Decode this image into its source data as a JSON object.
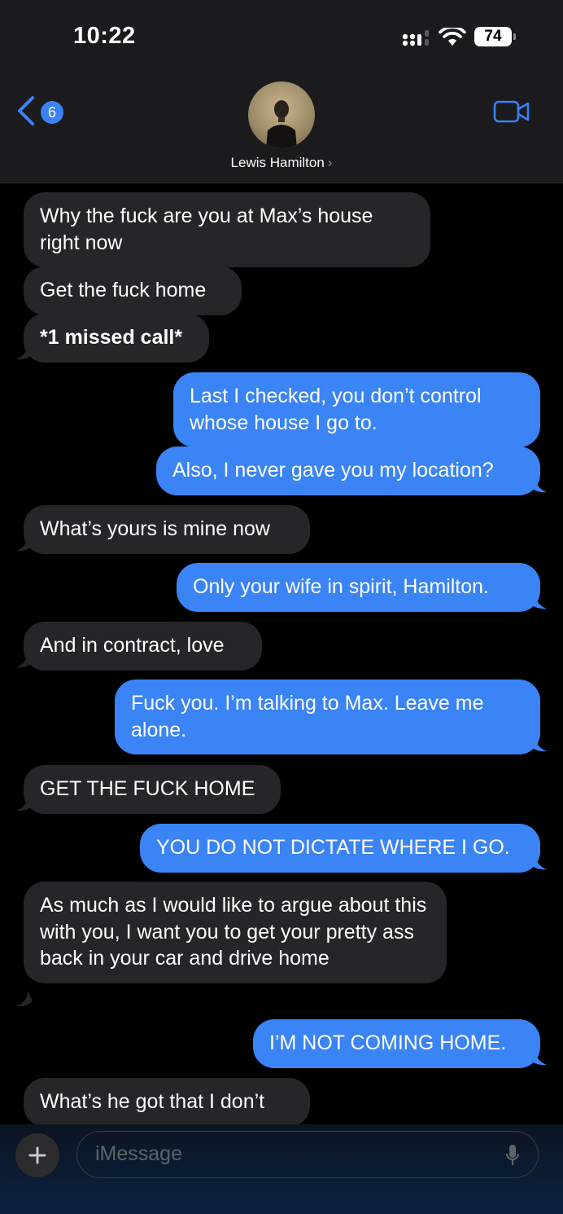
{
  "status_bar": {
    "time": "10:22",
    "battery": "74"
  },
  "header": {
    "back_count": "6",
    "contact_name": "Lewis Hamilton",
    "chevron": "›"
  },
  "messages": [
    {
      "from": "them",
      "text": "Why the fuck are you at Max’s house right now"
    },
    {
      "from": "them",
      "text": "Get the fuck home"
    },
    {
      "from": "them",
      "text": "*1 missed call*"
    },
    {
      "from": "me",
      "text": "Last I checked, you don’t control whose house I go to."
    },
    {
      "from": "me",
      "text": "Also, I never gave you my location?"
    },
    {
      "from": "them",
      "text": "What’s yours is mine now"
    },
    {
      "from": "me",
      "text": "Only your wife in spirit, Hamilton."
    },
    {
      "from": "them",
      "text": "And in contract, love"
    },
    {
      "from": "me",
      "text": "Fuck you. I’m talking to Max. Leave me alone."
    },
    {
      "from": "them",
      "text": "GET THE FUCK HOME"
    },
    {
      "from": "me",
      "text": "YOU DO NOT DICTATE WHERE I GO."
    },
    {
      "from": "them",
      "text": "As much as I would like to argue about this with you, I want you to get your pretty ass back in your car and drive home"
    },
    {
      "from": "me",
      "text": "I’M NOT COMING HOME."
    },
    {
      "from": "them",
      "text": "What’s he got that I don’t"
    }
  ],
  "composer": {
    "placeholder": "iMessage"
  },
  "colors": {
    "sent_bubble": "#3a84f5",
    "received_bubble": "#262628",
    "accent": "#3b82f6"
  },
  "icons": [
    "back-chevron-icon",
    "video-call-icon",
    "plus-icon",
    "microphone-icon",
    "signal-icon",
    "wifi-icon",
    "battery-icon"
  ]
}
